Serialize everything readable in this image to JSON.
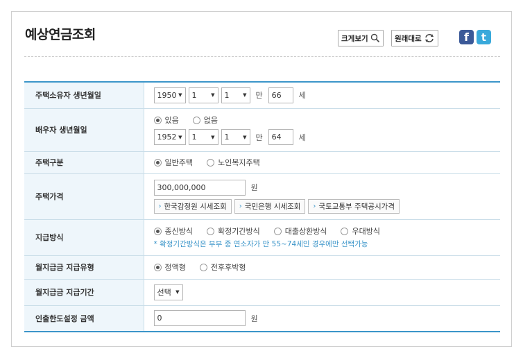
{
  "page": {
    "title": "예상연금조회",
    "enlarge_label": "크게보기",
    "reset_label": "원래대로"
  },
  "colors": {
    "accent": "#3b95c9",
    "header_bg": "#eef6fb",
    "facebook": "#3b5998",
    "twitter": "#39a9db"
  },
  "icons": [
    "search-icon",
    "reset-arrows-icon",
    "facebook-icon",
    "twitter-icon",
    "chevron-right-icon",
    "dropdown-arrow-icon"
  ],
  "form": {
    "owner_birth": {
      "label": "주택소유자 생년월일",
      "year": "1950",
      "month": "1",
      "day": "1",
      "age_prefix": "만",
      "age": "66",
      "age_unit": "세"
    },
    "spouse_birth": {
      "label": "배우자 생년월일",
      "opt_yes": "있음",
      "opt_no": "없음",
      "selected": "있음",
      "year": "1952",
      "month": "1",
      "day": "1",
      "age_prefix": "만",
      "age": "64",
      "age_unit": "세"
    },
    "house_type": {
      "label": "주택구분",
      "opt1": "일반주택",
      "opt2": "노인복지주택",
      "selected": "일반주택"
    },
    "house_price": {
      "label": "주택가격",
      "value": "300,000,000",
      "unit": "원",
      "btn1": "한국감정원 시세조회",
      "btn2": "국민은행 시세조회",
      "btn3": "국토교통부 주택공시가격"
    },
    "payment_method": {
      "label": "지급방식",
      "opt1": "종신방식",
      "opt2": "확정기간방식",
      "opt3": "대출상환방식",
      "opt4": "우대방식",
      "selected": "종신방식",
      "note": "* 확정기간방식은 부부 중 연소자가 만 55~74세인 경우에만 선택가능"
    },
    "monthly_type": {
      "label": "월지급금 지급유형",
      "opt1": "정액형",
      "opt2": "전후후박형",
      "selected": "정액형"
    },
    "monthly_period": {
      "label": "월지급금 지급기간",
      "value": "선택"
    },
    "withdraw_limit": {
      "label": "인출한도설정 금액",
      "value": "0",
      "unit": "원"
    }
  }
}
